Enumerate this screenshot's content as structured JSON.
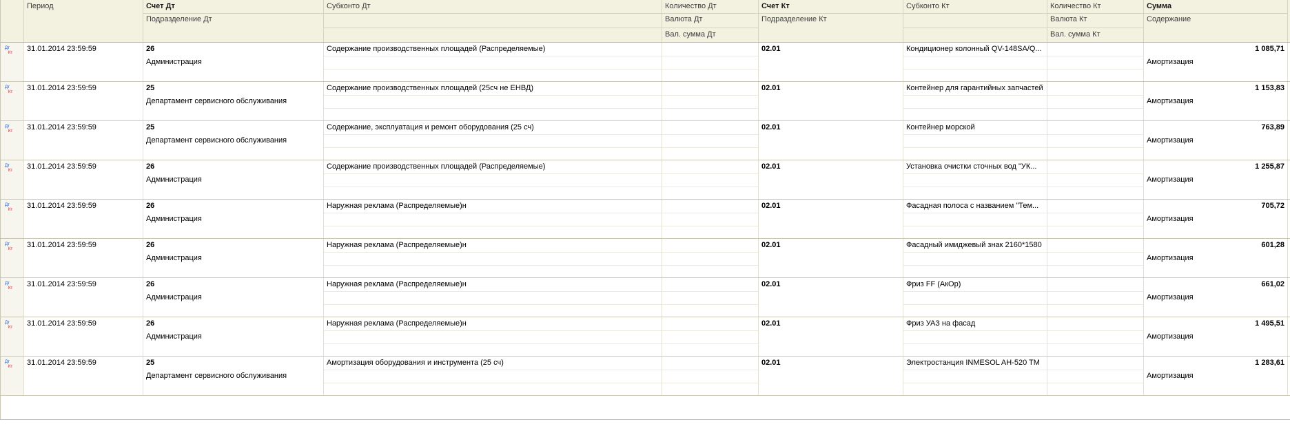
{
  "headers": {
    "period": "Период",
    "account_dt": "Счет Дт",
    "division_dt": "Подразделение Дт",
    "subconto_dt": "Субконто Дт",
    "qty_dt": "Количество Дт",
    "currency_dt": "Валюта Дт",
    "cur_sum_dt": "Вал. сумма Дт",
    "account_kt": "Счет Кт",
    "division_kt": "Подразделение Кт",
    "subconto_kt": "Субконто Кт",
    "qty_kt": "Количество Кт",
    "currency_kt": "Валюта Кт",
    "cur_sum_kt": "Вал. сумма Кт",
    "sum": "Сумма",
    "content": "Содержание"
  },
  "rows": [
    {
      "period": "31.01.2014 23:59:59",
      "account_dt": "26",
      "division_dt": "Администрация",
      "subconto_dt": "Содержание производственных площадей (Распределяемые)",
      "account_kt": "02.01",
      "subconto_kt": "Кондиционер колонный QV-148SA/Q...",
      "sum": "1 085,71",
      "content": "Амортизация"
    },
    {
      "period": "31.01.2014 23:59:59",
      "account_dt": "25",
      "division_dt": "Департамент сервисного обслуживания",
      "subconto_dt": "Содержание производственных площадей (25сч не ЕНВД)",
      "account_kt": "02.01",
      "subconto_kt": "Контейнер для гарантийных запчастей",
      "sum": "1 153,83",
      "content": "Амортизация"
    },
    {
      "period": "31.01.2014 23:59:59",
      "account_dt": "25",
      "division_dt": "Департамент сервисного обслуживания",
      "subconto_dt": "Содержание, эксплуатация и ремонт оборудования (25 сч)",
      "account_kt": "02.01",
      "subconto_kt": "Контейнер морской",
      "sum": "763,89",
      "content": "Амортизация"
    },
    {
      "period": "31.01.2014 23:59:59",
      "account_dt": "26",
      "division_dt": "Администрация",
      "subconto_dt": "Содержание производственных площадей (Распределяемые)",
      "account_kt": "02.01",
      "subconto_kt": "Установка очистки сточных вод \"УК...",
      "sum": "1 255,87",
      "content": "Амортизация"
    },
    {
      "period": "31.01.2014 23:59:59",
      "account_dt": "26",
      "division_dt": "Администрация",
      "subconto_dt": "Наружная реклама (Распределяемые)н",
      "account_kt": "02.01",
      "subconto_kt": "Фасадная полоса с названием \"Тем...",
      "sum": "705,72",
      "content": "Амортизация"
    },
    {
      "period": "31.01.2014 23:59:59",
      "account_dt": "26",
      "division_dt": "Администрация",
      "subconto_dt": "Наружная реклама (Распределяемые)н",
      "account_kt": "02.01",
      "subconto_kt": "Фасадный имиджевый знак 2160*1580",
      "sum": "601,28",
      "content": "Амортизация"
    },
    {
      "period": "31.01.2014 23:59:59",
      "account_dt": "26",
      "division_dt": "Администрация",
      "subconto_dt": "Наружная реклама (Распределяемые)н",
      "account_kt": "02.01",
      "subconto_kt": "Фриз FF (АкОр)",
      "sum": "661,02",
      "content": "Амортизация"
    },
    {
      "period": "31.01.2014 23:59:59",
      "account_dt": "26",
      "division_dt": "Администрация",
      "subconto_dt": "Наружная реклама (Распределяемые)н",
      "account_kt": "02.01",
      "subconto_kt": "Фриз УАЗ на фасад",
      "sum": "1 495,51",
      "content": "Амортизация"
    },
    {
      "period": "31.01.2014 23:59:59",
      "account_dt": "25",
      "division_dt": "Департамент сервисного обслуживания",
      "subconto_dt": "Амортизация оборудования и инструмента (25 сч)",
      "account_kt": "02.01",
      "subconto_kt": "Электростанция INMESOL AH-520 TM",
      "sum": "1 283,61",
      "content": "Амортизация"
    }
  ],
  "icons": {
    "row_icon": "dt-kt-posting-icon"
  },
  "colors": {
    "header_bg": "#f3f1e0",
    "grid_line": "#c9c6b6",
    "icon_dt": "#1f4fb5",
    "icon_kt": "#c0282d"
  }
}
